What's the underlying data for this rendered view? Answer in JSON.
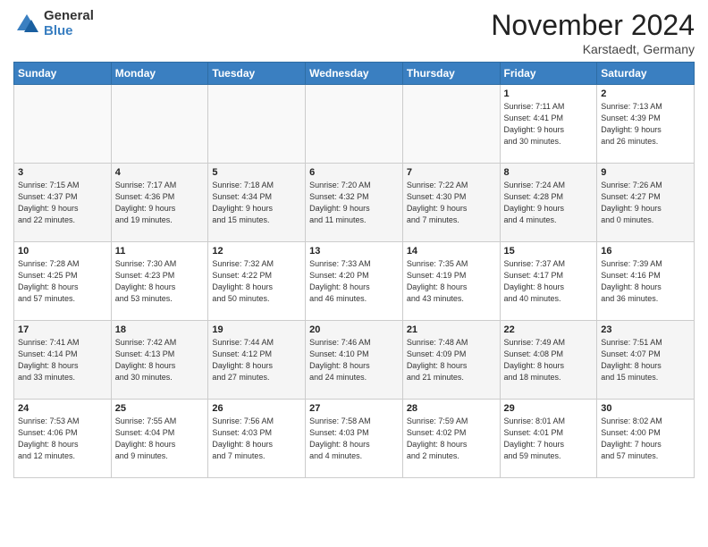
{
  "logo": {
    "general": "General",
    "blue": "Blue"
  },
  "title": "November 2024",
  "location": "Karstaedt, Germany",
  "weekdays": [
    "Sunday",
    "Monday",
    "Tuesday",
    "Wednesday",
    "Thursday",
    "Friday",
    "Saturday"
  ],
  "weeks": [
    [
      {
        "day": "",
        "info": ""
      },
      {
        "day": "",
        "info": ""
      },
      {
        "day": "",
        "info": ""
      },
      {
        "day": "",
        "info": ""
      },
      {
        "day": "",
        "info": ""
      },
      {
        "day": "1",
        "info": "Sunrise: 7:11 AM\nSunset: 4:41 PM\nDaylight: 9 hours\nand 30 minutes."
      },
      {
        "day": "2",
        "info": "Sunrise: 7:13 AM\nSunset: 4:39 PM\nDaylight: 9 hours\nand 26 minutes."
      }
    ],
    [
      {
        "day": "3",
        "info": "Sunrise: 7:15 AM\nSunset: 4:37 PM\nDaylight: 9 hours\nand 22 minutes."
      },
      {
        "day": "4",
        "info": "Sunrise: 7:17 AM\nSunset: 4:36 PM\nDaylight: 9 hours\nand 19 minutes."
      },
      {
        "day": "5",
        "info": "Sunrise: 7:18 AM\nSunset: 4:34 PM\nDaylight: 9 hours\nand 15 minutes."
      },
      {
        "day": "6",
        "info": "Sunrise: 7:20 AM\nSunset: 4:32 PM\nDaylight: 9 hours\nand 11 minutes."
      },
      {
        "day": "7",
        "info": "Sunrise: 7:22 AM\nSunset: 4:30 PM\nDaylight: 9 hours\nand 7 minutes."
      },
      {
        "day": "8",
        "info": "Sunrise: 7:24 AM\nSunset: 4:28 PM\nDaylight: 9 hours\nand 4 minutes."
      },
      {
        "day": "9",
        "info": "Sunrise: 7:26 AM\nSunset: 4:27 PM\nDaylight: 9 hours\nand 0 minutes."
      }
    ],
    [
      {
        "day": "10",
        "info": "Sunrise: 7:28 AM\nSunset: 4:25 PM\nDaylight: 8 hours\nand 57 minutes."
      },
      {
        "day": "11",
        "info": "Sunrise: 7:30 AM\nSunset: 4:23 PM\nDaylight: 8 hours\nand 53 minutes."
      },
      {
        "day": "12",
        "info": "Sunrise: 7:32 AM\nSunset: 4:22 PM\nDaylight: 8 hours\nand 50 minutes."
      },
      {
        "day": "13",
        "info": "Sunrise: 7:33 AM\nSunset: 4:20 PM\nDaylight: 8 hours\nand 46 minutes."
      },
      {
        "day": "14",
        "info": "Sunrise: 7:35 AM\nSunset: 4:19 PM\nDaylight: 8 hours\nand 43 minutes."
      },
      {
        "day": "15",
        "info": "Sunrise: 7:37 AM\nSunset: 4:17 PM\nDaylight: 8 hours\nand 40 minutes."
      },
      {
        "day": "16",
        "info": "Sunrise: 7:39 AM\nSunset: 4:16 PM\nDaylight: 8 hours\nand 36 minutes."
      }
    ],
    [
      {
        "day": "17",
        "info": "Sunrise: 7:41 AM\nSunset: 4:14 PM\nDaylight: 8 hours\nand 33 minutes."
      },
      {
        "day": "18",
        "info": "Sunrise: 7:42 AM\nSunset: 4:13 PM\nDaylight: 8 hours\nand 30 minutes."
      },
      {
        "day": "19",
        "info": "Sunrise: 7:44 AM\nSunset: 4:12 PM\nDaylight: 8 hours\nand 27 minutes."
      },
      {
        "day": "20",
        "info": "Sunrise: 7:46 AM\nSunset: 4:10 PM\nDaylight: 8 hours\nand 24 minutes."
      },
      {
        "day": "21",
        "info": "Sunrise: 7:48 AM\nSunset: 4:09 PM\nDaylight: 8 hours\nand 21 minutes."
      },
      {
        "day": "22",
        "info": "Sunrise: 7:49 AM\nSunset: 4:08 PM\nDaylight: 8 hours\nand 18 minutes."
      },
      {
        "day": "23",
        "info": "Sunrise: 7:51 AM\nSunset: 4:07 PM\nDaylight: 8 hours\nand 15 minutes."
      }
    ],
    [
      {
        "day": "24",
        "info": "Sunrise: 7:53 AM\nSunset: 4:06 PM\nDaylight: 8 hours\nand 12 minutes."
      },
      {
        "day": "25",
        "info": "Sunrise: 7:55 AM\nSunset: 4:04 PM\nDaylight: 8 hours\nand 9 minutes."
      },
      {
        "day": "26",
        "info": "Sunrise: 7:56 AM\nSunset: 4:03 PM\nDaylight: 8 hours\nand 7 minutes."
      },
      {
        "day": "27",
        "info": "Sunrise: 7:58 AM\nSunset: 4:03 PM\nDaylight: 8 hours\nand 4 minutes."
      },
      {
        "day": "28",
        "info": "Sunrise: 7:59 AM\nSunset: 4:02 PM\nDaylight: 8 hours\nand 2 minutes."
      },
      {
        "day": "29",
        "info": "Sunrise: 8:01 AM\nSunset: 4:01 PM\nDaylight: 7 hours\nand 59 minutes."
      },
      {
        "day": "30",
        "info": "Sunrise: 8:02 AM\nSunset: 4:00 PM\nDaylight: 7 hours\nand 57 minutes."
      }
    ]
  ]
}
